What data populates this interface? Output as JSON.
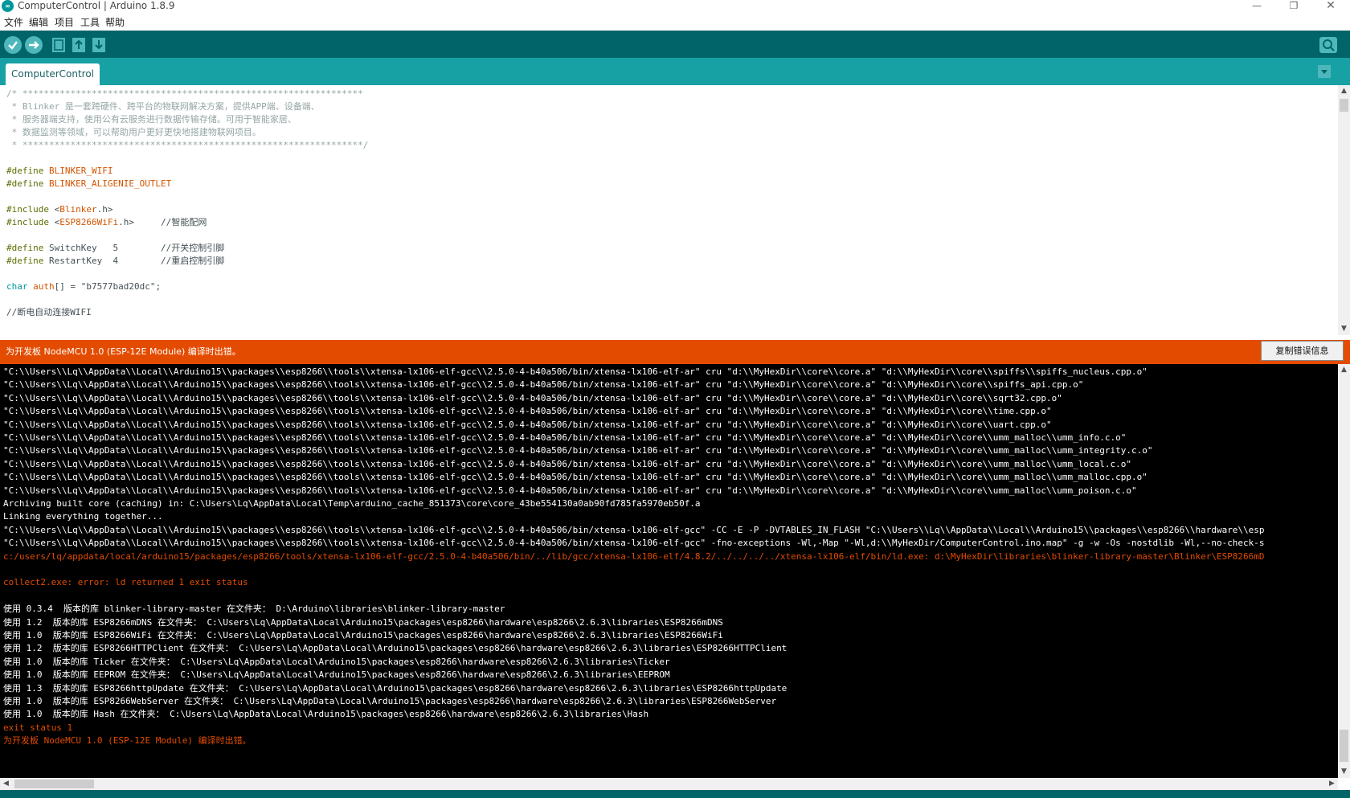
{
  "window": {
    "icon_label": "∞",
    "title": "ComputerControl | Arduino 1.8.9",
    "minimize_glyph": "—",
    "maximize_glyph": "❐",
    "close_glyph": "✕"
  },
  "menu": {
    "items": [
      {
        "label": "文件"
      },
      {
        "label": "编辑"
      },
      {
        "label": "项目"
      },
      {
        "label": "工具"
      },
      {
        "label": "帮助"
      }
    ]
  },
  "toolbar": {
    "buttons": [
      {
        "name": "verify",
        "icon": "check-icon"
      },
      {
        "name": "upload",
        "icon": "arrow-right-icon"
      },
      {
        "name": "new",
        "icon": "new-file-icon"
      },
      {
        "name": "open",
        "icon": "arrow-up-icon"
      },
      {
        "name": "save",
        "icon": "arrow-down-icon"
      }
    ],
    "serial_monitor_icon": "magnifier-icon"
  },
  "tabs": {
    "active": "ComputerControl",
    "menu_glyph": "▼"
  },
  "editor": {
    "lines": [
      {
        "segments": [
          {
            "t": "/* ****************************************************************",
            "c": "c-comment"
          }
        ]
      },
      {
        "segments": [
          {
            "t": " * Blinker 是一套跨硬件、跨平台的物联网解决方案，提供APP端、设备端、",
            "c": "c-comment"
          }
        ]
      },
      {
        "segments": [
          {
            "t": " * 服务器端支持，使用公有云服务进行数据传输存储。可用于智能家居、",
            "c": "c-comment"
          }
        ]
      },
      {
        "segments": [
          {
            "t": " * 数据监测等领域，可以帮助用户更好更快地搭建物联网项目。",
            "c": "c-comment"
          }
        ]
      },
      {
        "segments": [
          {
            "t": " * ****************************************************************/",
            "c": "c-comment"
          }
        ]
      },
      {
        "segments": []
      },
      {
        "segments": [
          {
            "t": "#define ",
            "c": "c-kw"
          },
          {
            "t": "BLINKER_WIFI",
            "c": "c-macro"
          }
        ]
      },
      {
        "segments": [
          {
            "t": "#define ",
            "c": "c-kw"
          },
          {
            "t": "BLINKER_ALIGENIE_OUTLET",
            "c": "c-macro"
          }
        ]
      },
      {
        "segments": []
      },
      {
        "segments": [
          {
            "t": "#include ",
            "c": "c-kw"
          },
          {
            "t": "<",
            "c": "c-norm"
          },
          {
            "t": "Blinker",
            "c": "c-lib"
          },
          {
            "t": ".h>",
            "c": "c-norm"
          }
        ]
      },
      {
        "segments": [
          {
            "t": "#include ",
            "c": "c-kw"
          },
          {
            "t": "<",
            "c": "c-norm"
          },
          {
            "t": "ESP8266WiFi",
            "c": "c-lib"
          },
          {
            "t": ".h>     ",
            "c": "c-norm"
          },
          {
            "t": "//智能配网",
            "c": "c-norm"
          }
        ]
      },
      {
        "segments": []
      },
      {
        "segments": [
          {
            "t": "#define ",
            "c": "c-kw"
          },
          {
            "t": "SwitchKey   5        //开关控制引脚",
            "c": "c-norm"
          }
        ]
      },
      {
        "segments": [
          {
            "t": "#define ",
            "c": "c-kw"
          },
          {
            "t": "RestartKey  4        //重启控制引脚",
            "c": "c-norm"
          }
        ]
      },
      {
        "segments": []
      },
      {
        "segments": [
          {
            "t": "char ",
            "c": "c-type"
          },
          {
            "t": "auth",
            "c": "c-macro"
          },
          {
            "t": "[] = \"b7577bad20dc\";",
            "c": "c-norm"
          }
        ]
      },
      {
        "segments": []
      },
      {
        "segments": [
          {
            "t": "//断电自动连接WIFI",
            "c": "c-norm"
          }
        ]
      }
    ]
  },
  "status": {
    "message": "为开发板 NodeMCU 1.0 (ESP-12E Module) 编译时出错。",
    "copy_button": "复制错误信息"
  },
  "console": {
    "lines": [
      {
        "text": "\"C:\\\\Users\\\\Lq\\\\AppData\\\\Local\\\\Arduino15\\\\packages\\\\esp8266\\\\tools\\\\xtensa-lx106-elf-gcc\\\\2.5.0-4-b40a506/bin/xtensa-lx106-elf-ar\" cru \"d:\\\\MyHexDir\\\\core\\\\core.a\" \"d:\\\\MyHexDir\\\\core\\\\spiffs\\\\spiffs_nucleus.cpp.o\"",
        "err": false
      },
      {
        "text": "\"C:\\\\Users\\\\Lq\\\\AppData\\\\Local\\\\Arduino15\\\\packages\\\\esp8266\\\\tools\\\\xtensa-lx106-elf-gcc\\\\2.5.0-4-b40a506/bin/xtensa-lx106-elf-ar\" cru \"d:\\\\MyHexDir\\\\core\\\\core.a\" \"d:\\\\MyHexDir\\\\core\\\\spiffs_api.cpp.o\"",
        "err": false
      },
      {
        "text": "\"C:\\\\Users\\\\Lq\\\\AppData\\\\Local\\\\Arduino15\\\\packages\\\\esp8266\\\\tools\\\\xtensa-lx106-elf-gcc\\\\2.5.0-4-b40a506/bin/xtensa-lx106-elf-ar\" cru \"d:\\\\MyHexDir\\\\core\\\\core.a\" \"d:\\\\MyHexDir\\\\core\\\\sqrt32.cpp.o\"",
        "err": false
      },
      {
        "text": "\"C:\\\\Users\\\\Lq\\\\AppData\\\\Local\\\\Arduino15\\\\packages\\\\esp8266\\\\tools\\\\xtensa-lx106-elf-gcc\\\\2.5.0-4-b40a506/bin/xtensa-lx106-elf-ar\" cru \"d:\\\\MyHexDir\\\\core\\\\core.a\" \"d:\\\\MyHexDir\\\\core\\\\time.cpp.o\"",
        "err": false
      },
      {
        "text": "\"C:\\\\Users\\\\Lq\\\\AppData\\\\Local\\\\Arduino15\\\\packages\\\\esp8266\\\\tools\\\\xtensa-lx106-elf-gcc\\\\2.5.0-4-b40a506/bin/xtensa-lx106-elf-ar\" cru \"d:\\\\MyHexDir\\\\core\\\\core.a\" \"d:\\\\MyHexDir\\\\core\\\\uart.cpp.o\"",
        "err": false
      },
      {
        "text": "\"C:\\\\Users\\\\Lq\\\\AppData\\\\Local\\\\Arduino15\\\\packages\\\\esp8266\\\\tools\\\\xtensa-lx106-elf-gcc\\\\2.5.0-4-b40a506/bin/xtensa-lx106-elf-ar\" cru \"d:\\\\MyHexDir\\\\core\\\\core.a\" \"d:\\\\MyHexDir\\\\core\\\\umm_malloc\\\\umm_info.c.o\"",
        "err": false
      },
      {
        "text": "\"C:\\\\Users\\\\Lq\\\\AppData\\\\Local\\\\Arduino15\\\\packages\\\\esp8266\\\\tools\\\\xtensa-lx106-elf-gcc\\\\2.5.0-4-b40a506/bin/xtensa-lx106-elf-ar\" cru \"d:\\\\MyHexDir\\\\core\\\\core.a\" \"d:\\\\MyHexDir\\\\core\\\\umm_malloc\\\\umm_integrity.c.o\"",
        "err": false
      },
      {
        "text": "\"C:\\\\Users\\\\Lq\\\\AppData\\\\Local\\\\Arduino15\\\\packages\\\\esp8266\\\\tools\\\\xtensa-lx106-elf-gcc\\\\2.5.0-4-b40a506/bin/xtensa-lx106-elf-ar\" cru \"d:\\\\MyHexDir\\\\core\\\\core.a\" \"d:\\\\MyHexDir\\\\core\\\\umm_malloc\\\\umm_local.c.o\"",
        "err": false
      },
      {
        "text": "\"C:\\\\Users\\\\Lq\\\\AppData\\\\Local\\\\Arduino15\\\\packages\\\\esp8266\\\\tools\\\\xtensa-lx106-elf-gcc\\\\2.5.0-4-b40a506/bin/xtensa-lx106-elf-ar\" cru \"d:\\\\MyHexDir\\\\core\\\\core.a\" \"d:\\\\MyHexDir\\\\core\\\\umm_malloc\\\\umm_malloc.cpp.o\"",
        "err": false
      },
      {
        "text": "\"C:\\\\Users\\\\Lq\\\\AppData\\\\Local\\\\Arduino15\\\\packages\\\\esp8266\\\\tools\\\\xtensa-lx106-elf-gcc\\\\2.5.0-4-b40a506/bin/xtensa-lx106-elf-ar\" cru \"d:\\\\MyHexDir\\\\core\\\\core.a\" \"d:\\\\MyHexDir\\\\core\\\\umm_malloc\\\\umm_poison.c.o\"",
        "err": false
      },
      {
        "text": "Archiving built core (caching) in: C:\\Users\\Lq\\AppData\\Local\\Temp\\arduino_cache_851373\\core\\core_43be554130a0ab90fd785fa5970eb50f.a",
        "err": false
      },
      {
        "text": "Linking everything together...",
        "err": false
      },
      {
        "text": "\"C:\\\\Users\\\\Lq\\\\AppData\\\\Local\\\\Arduino15\\\\packages\\\\esp8266\\\\tools\\\\xtensa-lx106-elf-gcc\\\\2.5.0-4-b40a506/bin/xtensa-lx106-elf-gcc\" -CC -E -P -DVTABLES_IN_FLASH \"C:\\\\Users\\\\Lq\\\\AppData\\\\Local\\\\Arduino15\\\\packages\\\\esp8266\\\\hardware\\\\esp",
        "err": false
      },
      {
        "text": "\"C:\\\\Users\\\\Lq\\\\AppData\\\\Local\\\\Arduino15\\\\packages\\\\esp8266\\\\tools\\\\xtensa-lx106-elf-gcc\\\\2.5.0-4-b40a506/bin/xtensa-lx106-elf-gcc\" -fno-exceptions -Wl,-Map \"-Wl,d:\\\\MyHexDir/ComputerControl.ino.map\" -g -w -Os -nostdlib -Wl,--no-check-s",
        "err": false
      },
      {
        "text": "c:/users/lq/appdata/local/arduino15/packages/esp8266/tools/xtensa-lx106-elf-gcc/2.5.0-4-b40a506/bin/../lib/gcc/xtensa-lx106-elf/4.8.2/../../../../xtensa-lx106-elf/bin/ld.exe: d:\\MyHexDir\\libraries\\blinker-library-master\\Blinker\\ESP8266mD",
        "err": true
      },
      {
        "text": "",
        "err": false
      },
      {
        "text": "collect2.exe: error: ld returned 1 exit status",
        "err": true
      },
      {
        "text": "",
        "err": false
      },
      {
        "text": "使用 0.3.4  版本的库 blinker-library-master 在文件夹： D:\\Arduino\\libraries\\blinker-library-master",
        "err": false
      },
      {
        "text": "使用 1.2  版本的库 ESP8266mDNS 在文件夹： C:\\Users\\Lq\\AppData\\Local\\Arduino15\\packages\\esp8266\\hardware\\esp8266\\2.6.3\\libraries\\ESP8266mDNS",
        "err": false
      },
      {
        "text": "使用 1.0  版本的库 ESP8266WiFi 在文件夹： C:\\Users\\Lq\\AppData\\Local\\Arduino15\\packages\\esp8266\\hardware\\esp8266\\2.6.3\\libraries\\ESP8266WiFi",
        "err": false
      },
      {
        "text": "使用 1.2  版本的库 ESP8266HTTPClient 在文件夹： C:\\Users\\Lq\\AppData\\Local\\Arduino15\\packages\\esp8266\\hardware\\esp8266\\2.6.3\\libraries\\ESP8266HTTPClient",
        "err": false
      },
      {
        "text": "使用 1.0  版本的库 Ticker 在文件夹： C:\\Users\\Lq\\AppData\\Local\\Arduino15\\packages\\esp8266\\hardware\\esp8266\\2.6.3\\libraries\\Ticker",
        "err": false
      },
      {
        "text": "使用 1.0  版本的库 EEPROM 在文件夹： C:\\Users\\Lq\\AppData\\Local\\Arduino15\\packages\\esp8266\\hardware\\esp8266\\2.6.3\\libraries\\EEPROM",
        "err": false
      },
      {
        "text": "使用 1.3  版本的库 ESP8266httpUpdate 在文件夹： C:\\Users\\Lq\\AppData\\Local\\Arduino15\\packages\\esp8266\\hardware\\esp8266\\2.6.3\\libraries\\ESP8266httpUpdate",
        "err": false
      },
      {
        "text": "使用 1.0  版本的库 ESP8266WebServer 在文件夹： C:\\Users\\Lq\\AppData\\Local\\Arduino15\\packages\\esp8266\\hardware\\esp8266\\2.6.3\\libraries\\ESP8266WebServer",
        "err": false
      },
      {
        "text": "使用 1.0  版本的库 Hash 在文件夹： C:\\Users\\Lq\\AppData\\Local\\Arduino15\\packages\\esp8266\\hardware\\esp8266\\2.6.3\\libraries\\Hash",
        "err": false
      },
      {
        "text": "exit status 1",
        "err": true
      },
      {
        "text": "为开发板 NodeMCU 1.0 (ESP-12E Module) 编译时出错。",
        "err": true
      }
    ]
  },
  "scroll": {
    "up": "▲",
    "down": "▼",
    "left": "◀",
    "right": "▶"
  },
  "colors": {
    "toolbar": "#006468",
    "tabbar": "#17a1a5",
    "status_error": "#e34c00",
    "console_bg": "#000000"
  }
}
